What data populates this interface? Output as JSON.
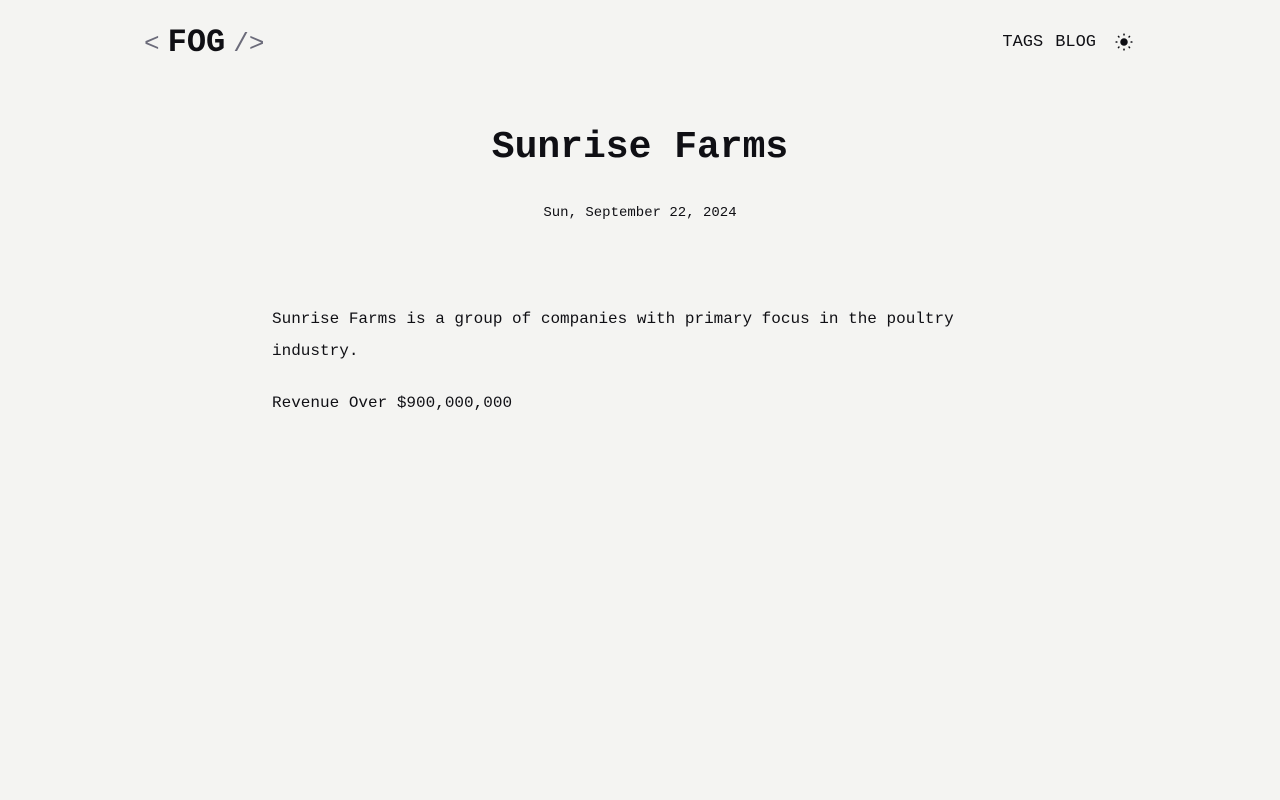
{
  "header": {
    "logo_open": "<",
    "logo_name": "FOG",
    "logo_close": "/>",
    "nav": [
      {
        "label": "TAGS"
      },
      {
        "label": "BLOG"
      }
    ],
    "theme_icon": "sun-icon"
  },
  "post": {
    "title": "Sunrise Farms",
    "date": "Sun, September 22, 2024",
    "paragraphs": [
      "Sunrise Farms is a group of companies with primary focus in the poultry industry.",
      "Revenue Over $900,000,000"
    ]
  }
}
